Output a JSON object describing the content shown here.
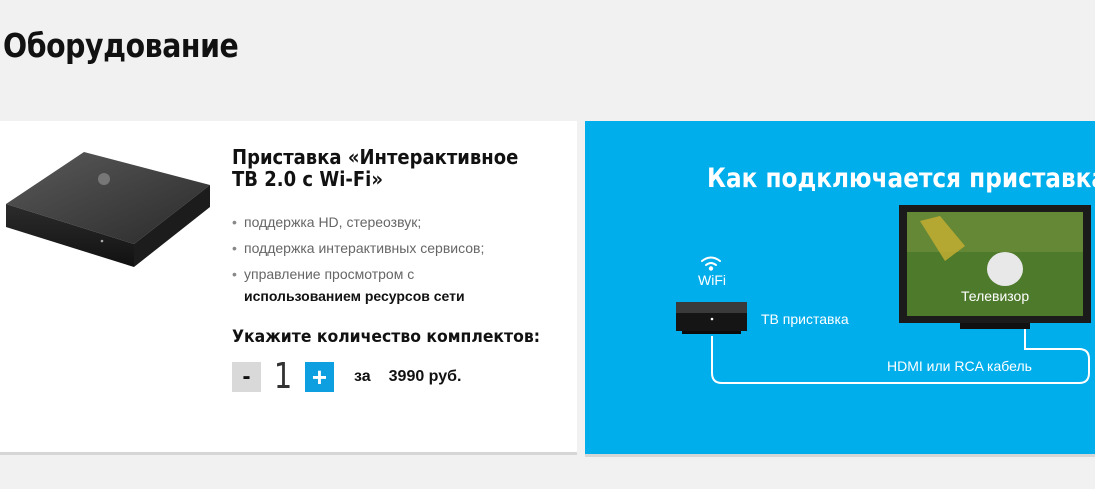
{
  "page": {
    "title": "Оборудование"
  },
  "product": {
    "name": "Приставка «Интерактивное ТВ 2.0 с Wi-Fi»",
    "features": [
      {
        "text": "поддержка HD, стереозвук;",
        "emphasis": ""
      },
      {
        "text": "поддержка интерактивных сервисов;",
        "emphasis": ""
      },
      {
        "text": "управление просмотром с",
        "emphasis": "использованием ресурсов сети"
      }
    ],
    "quantity_label": "Укажите количество комплектов:",
    "quantity": "1",
    "minus_label": "-",
    "plus_label": "+",
    "price_prefix": "за",
    "price": "3990 руб."
  },
  "info_panel": {
    "title": "Как подключается приставка?",
    "wifi_label": "WiFi",
    "box_label": "ТВ приставка",
    "tv_label": "Телевизор",
    "cable_label": "HDMI или RCA кабель",
    "background_color": "#00aeec"
  },
  "colors": {
    "accent": "#0d9fe0",
    "minus_button": "#d9d9d9"
  }
}
